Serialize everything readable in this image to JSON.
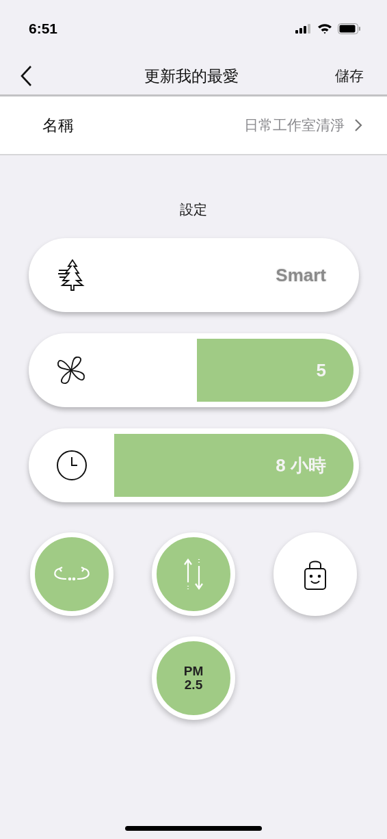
{
  "status_bar": {
    "time": "6:51"
  },
  "nav": {
    "title": "更新我的最愛",
    "action": "儲存"
  },
  "name_row": {
    "label": "名稱",
    "value": "日常工作室清淨"
  },
  "section_title": "設定",
  "controls": [
    {
      "kind": "mode",
      "value": "Smart"
    },
    {
      "kind": "level",
      "value": "5"
    },
    {
      "kind": "level",
      "value": "8 小時"
    }
  ],
  "toggles": [
    {
      "on": true
    },
    {
      "on": true
    },
    {
      "on": false
    },
    {
      "label": "PM\n2.5",
      "on": true
    }
  ]
}
